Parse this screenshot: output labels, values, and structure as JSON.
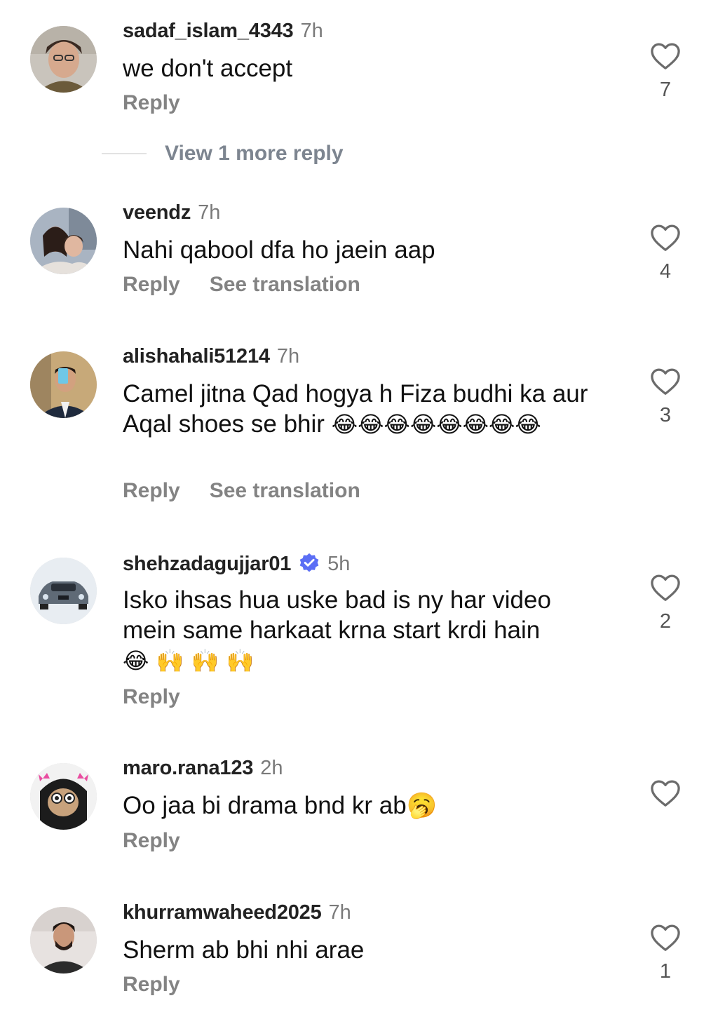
{
  "comments": [
    {
      "username": "sadaf_islam_4343",
      "time": "7h",
      "text": "we don't accept",
      "reply": "Reply",
      "likes": "7",
      "avatar_icon": "woman-glasses-avatar"
    },
    {
      "username": "veendz",
      "time": "7h",
      "text": "Nahi qabool dfa ho jaein aap",
      "reply": "Reply",
      "translation": "See translation",
      "likes": "4",
      "avatar_icon": "two-people-selfie-avatar"
    },
    {
      "username": "alishahali51214",
      "time": "7h",
      "text": "Camel jitna Qad hogya h Fiza budhi ka aur Aqal shoes se bhir",
      "reply": "Reply",
      "translation": "See translation",
      "likes": "3",
      "avatar_icon": "man-phone-selfie-avatar",
      "emoji": "😂",
      "emoji_count": 8
    },
    {
      "username": "shehzadagujjar01",
      "time": "5h",
      "text": "Isko ihsas hua uske bad is ny har video mein same harkaat krna start krdi hain",
      "reply": "Reply",
      "likes": "2",
      "avatar_icon": "car-avatar",
      "emoji": "😂 🙌 🙌 🙌"
    },
    {
      "username": "maro.rana123",
      "time": "2h",
      "text": "Oo jaa bi drama bnd kr ab",
      "reply": "Reply",
      "likes": "",
      "avatar_icon": "cat-glasses-avatar",
      "emoji": "🥱"
    },
    {
      "username": "khurramwaheed2025",
      "time": "7h",
      "text": "Sherm ab bhi nhi arae",
      "reply": "Reply",
      "likes": "1",
      "avatar_icon": "man-portrait-avatar"
    }
  ],
  "view_more": {
    "label": "View 1 more reply"
  },
  "colors": {
    "username": "#222222",
    "secondary": "#838383",
    "verified": "#5b6ef5"
  }
}
